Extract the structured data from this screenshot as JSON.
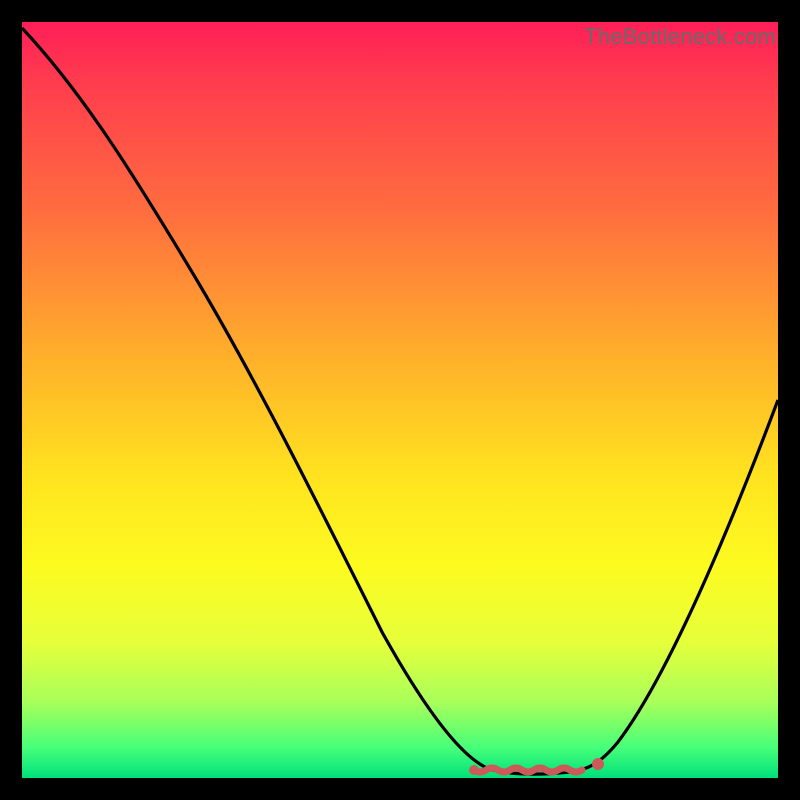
{
  "watermark": "TheBottleneck.com",
  "chart_data": {
    "type": "line",
    "title": "",
    "xlabel": "",
    "ylabel": "",
    "xlim": [
      0,
      100
    ],
    "ylim": [
      0,
      100
    ],
    "x": [
      0,
      5,
      10,
      15,
      20,
      25,
      30,
      35,
      40,
      45,
      50,
      55,
      58,
      62,
      66,
      70,
      73,
      76,
      80,
      85,
      90,
      95,
      100
    ],
    "values": [
      99,
      91,
      82,
      73,
      64,
      55,
      47,
      39,
      31,
      23,
      16,
      9,
      5,
      2,
      1,
      1,
      1,
      2,
      6,
      14,
      25,
      37,
      50
    ],
    "flat_zone_center_x": 68,
    "flat_zone_width": 16,
    "flat_zone_color": "#cc5a5a",
    "end_dot_x": 76,
    "end_dot_color": "#cc5a5a",
    "gradient_stops": [
      {
        "pct": 0,
        "color": "#ff1f58"
      },
      {
        "pct": 25,
        "color": "#ff6d3f"
      },
      {
        "pct": 50,
        "color": "#ffd51f"
      },
      {
        "pct": 72,
        "color": "#fdfb20"
      },
      {
        "pct": 90,
        "color": "#a8ff5a"
      },
      {
        "pct": 100,
        "color": "#00e07a"
      }
    ]
  }
}
